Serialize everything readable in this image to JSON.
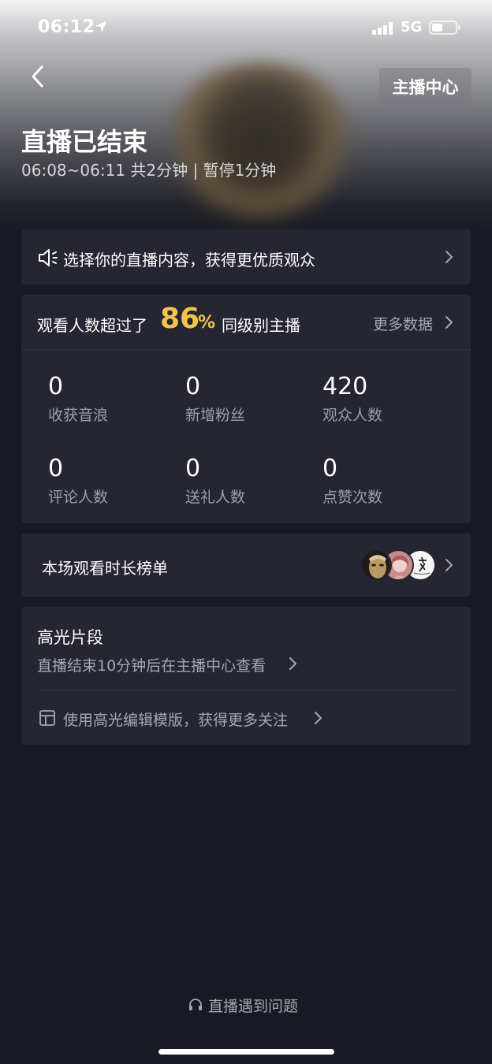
{
  "status_bar": {
    "time": "06:12",
    "network": "5G"
  },
  "header": {
    "anchor_center_label": "主播中心",
    "title": "直播已结束",
    "subtitle": "06:08~06:11 共2分钟 | 暂停1分钟"
  },
  "tip": {
    "text": "选择你的直播内容，获得更优质观众"
  },
  "stats": {
    "rank_prefix": "观看人数超过了",
    "rank_value": "86",
    "rank_unit": "%",
    "rank_suffix": "同级别主播",
    "more_label": "更多数据",
    "items": [
      {
        "value": "0",
        "label": "收获音浪"
      },
      {
        "value": "0",
        "label": "新增粉丝"
      },
      {
        "value": "420",
        "label": "观众人数"
      },
      {
        "value": "0",
        "label": "评论人数"
      },
      {
        "value": "0",
        "label": "送礼人数"
      },
      {
        "value": "0",
        "label": "点赞次数"
      }
    ]
  },
  "watch_rank": {
    "title": "本场观看时长榜单"
  },
  "highlights": {
    "title": "高光片段",
    "subtitle": "直播结束10分钟后在主播中心查看",
    "template_tip": "使用高光编辑模版，获得更多关注"
  },
  "footer": {
    "help_label": "直播遇到问题"
  },
  "colors": {
    "accent": "#f4c34a",
    "card": "#252631",
    "background": "#181923"
  }
}
